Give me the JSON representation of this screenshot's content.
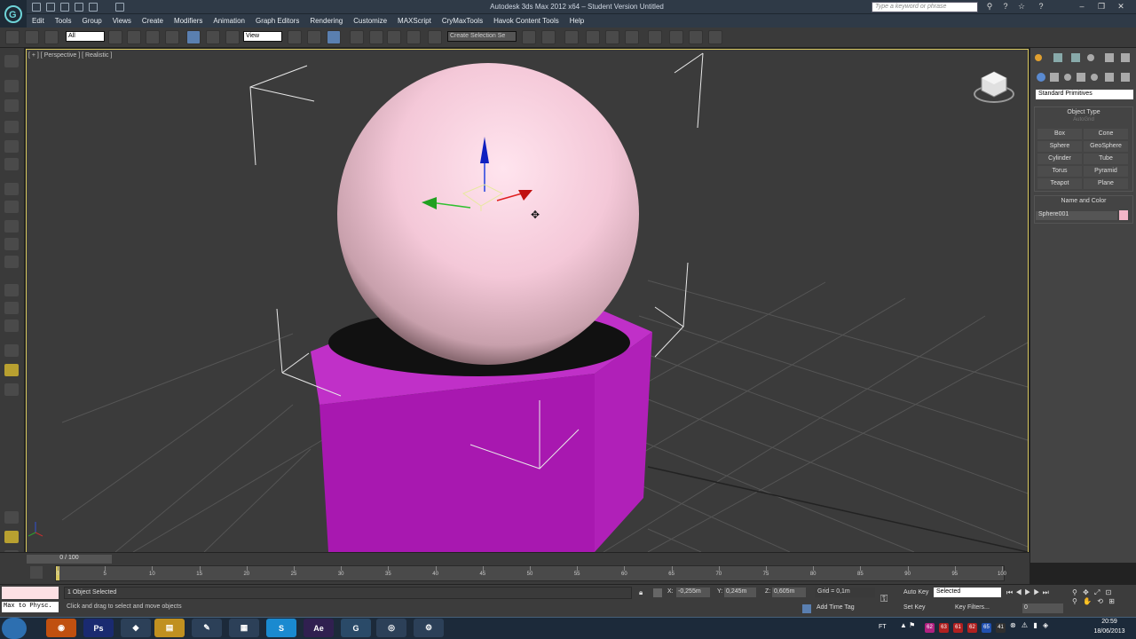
{
  "app": {
    "title": "Autodesk 3ds Max 2012 x64 – Student Version   Untitled",
    "search_placeholder": "Type a keyword or phrase"
  },
  "menu": [
    "Edit",
    "Tools",
    "Group",
    "Views",
    "Create",
    "Modifiers",
    "Animation",
    "Graph Editors",
    "Rendering",
    "Customize",
    "MAXScript",
    "CryMaxTools",
    "Havok Content Tools",
    "Help"
  ],
  "toolbar": {
    "selection_filter": "All",
    "reference_coord": "View",
    "named_selection": "Create Selection Se"
  },
  "viewport": {
    "label": "[ + ] [ Perspective ] [ Realistic ]"
  },
  "command_panel": {
    "category": "Standard Primitives",
    "object_type_header": "Object Type",
    "autogrid": "AutoGrid",
    "object_buttons": [
      "Box",
      "Cone",
      "Sphere",
      "GeoSphere",
      "Cylinder",
      "Tube",
      "Torus",
      "Pyramid",
      "Teapot",
      "Plane"
    ],
    "name_color_header": "Name and Color",
    "object_name": "Sphere001",
    "object_color": "#f4b6c8"
  },
  "timeline": {
    "frame_counter": "0 / 100",
    "ticks": [
      "0",
      "5",
      "10",
      "15",
      "20",
      "25",
      "30",
      "35",
      "40",
      "45",
      "50",
      "55",
      "60",
      "65",
      "70",
      "75",
      "80",
      "85",
      "90",
      "95",
      "100"
    ]
  },
  "status": {
    "maxscript_prompt": "Max to Physc.",
    "selected": "1 Object Selected",
    "prompt": "Click and drag to select and move objects",
    "x_label": "X:",
    "x": "-0,255m",
    "y_label": "Y:",
    "y": "0,245m",
    "z_label": "Z:",
    "z": "0,605m",
    "grid": "Grid = 0,1m",
    "auto_key": "Auto Key",
    "set_key": "Set Key",
    "key_mode": "Selected",
    "key_filters": "Key Filters...",
    "add_time_tag": "Add Time Tag",
    "current_frame": "0"
  },
  "taskbar": {
    "language": "FT",
    "time": "20:59",
    "date": "18/06/2013",
    "tray_numbers": [
      "62",
      "63",
      "61",
      "62",
      "65",
      "41"
    ]
  },
  "colors": {
    "sphere": "#f4c8d8",
    "box": "#b020b8",
    "viewport_border": "#d8c860"
  }
}
